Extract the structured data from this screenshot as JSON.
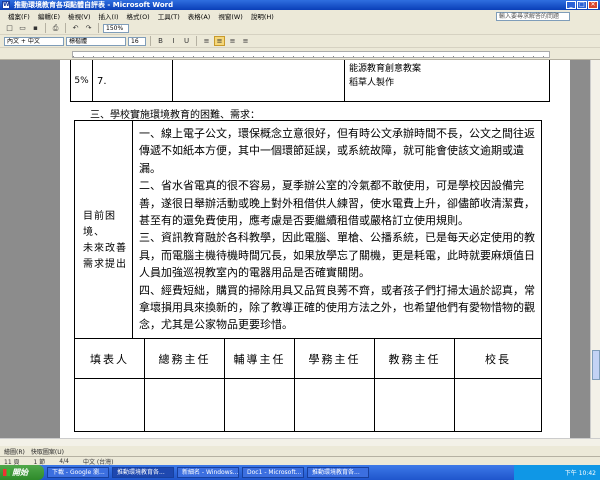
{
  "window": {
    "title": "推動環境教育各項點體自評表 - Microsoft Word",
    "min_label": "_",
    "max_label": "□",
    "close_label": "✕"
  },
  "menu": [
    "檔案(F)",
    "編輯(E)",
    "檢視(V)",
    "插入(I)",
    "格式(O)",
    "工具(T)",
    "表格(A)",
    "視窗(W)",
    "說明(H)"
  ],
  "help_placeholder": "輸入要尋求解答的問題",
  "toolbar": {
    "zoom": "150%",
    "style": "內文 + 中文",
    "font": "標楷體",
    "size": "16",
    "icon_new": "□",
    "icon_open": "▭",
    "icon_save": "▪",
    "icon_print": "⎙",
    "icon_undo": "↶",
    "icon_redo": "↷",
    "icon_bold": "B",
    "icon_italic": "I",
    "icon_underline": "U",
    "icon_align_left": "≡",
    "icon_align_center": "≡",
    "icon_align_right": "≡",
    "icon_justify": "≡"
  },
  "doc": {
    "top_row": {
      "percent": "5%",
      "number": "7.",
      "lines": [
        "能源教育創意教案",
        "稻草人製作"
      ]
    },
    "section_heading": "三、學校實施環境教育的困難、需求：",
    "left_label": [
      "目前困境、",
      "未來改善",
      "需求提出"
    ],
    "paragraphs": [
      "一、線上電子公文，環保概念立意很好，但有時公文承辦時間不長，公文之間往返傳遞不如紙本方便，其中一個環節延誤，或系統故障，就可能會使該文逾期或遺漏。",
      "二、省水省電真的很不容易，夏季辦公室的冷氣都不敢使用，可是學校因設備完善，遂很日舉辦活動或晚上對外租借供人練習，使水電費上升，卻儘節收清潔費，甚至有的還免費使用，應考慮是否要繼續租借或嚴格訂立使用規則。",
      "三、資訊教育融於各科教學，因此電腦、單槍、公播系統，已是每天必定使用的教具，而電腦主機待機時間冗長，如果放學忘了關機，更是耗電，此時就要麻煩值日人員加強巡視教室內的電器用品是否確實關閉。",
      "四、經費短絀，購買的掃除用具又品質良莠不齊，或者孩子們打掃太過於認真，常拿壞損用具來換新的，除了教導正確的使用方法之外，也希望他們有愛物惜物的觀念，尤其是公家物品更要珍惜。"
    ],
    "signature_headers": [
      "填表人",
      "總務主任",
      "輔導主任",
      "學務主任",
      "教務主任",
      "校長"
    ]
  },
  "drawbar": [
    "繪圖(R)",
    "快取圖案(U)"
  ],
  "status": {
    "page": "11 頁",
    "section": "1 節",
    "pages": "4/4",
    "language": "中文 (台灣)"
  },
  "taskbar": {
    "start": "開始",
    "tasks": [
      "下載 - Google 瀏...",
      "推動環境教育各...",
      "新細名 - Windows...",
      "Doc1 - Microsoft...",
      "推動環境教育各..."
    ],
    "clock": "下午 10:42"
  }
}
